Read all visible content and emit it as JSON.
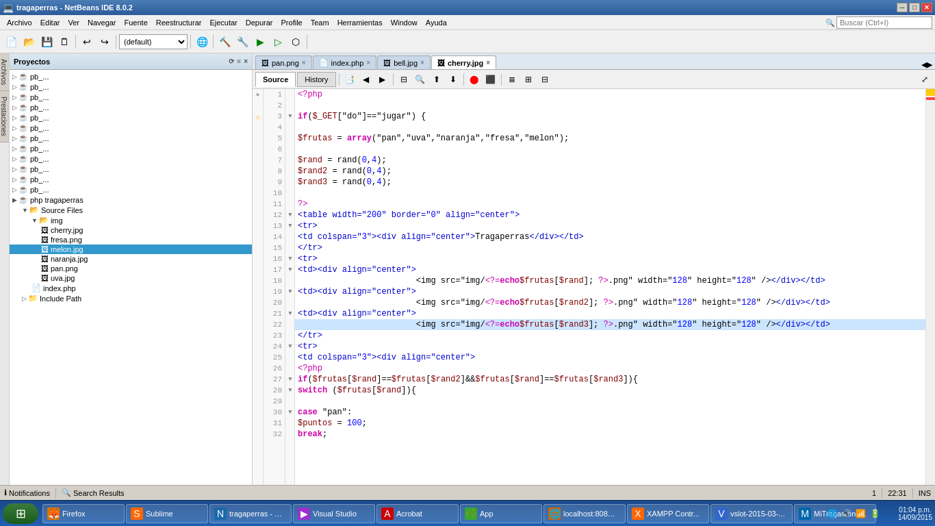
{
  "window": {
    "title": "tragaperras - NetBeans IDE 8.0.2",
    "controls": [
      "minimize",
      "restore",
      "close"
    ]
  },
  "menu": {
    "items": [
      "Archivo",
      "Editar",
      "Ver",
      "Navegar",
      "Fuente",
      "Reestructurar",
      "Ejecutar",
      "Depurar",
      "Profile",
      "Team",
      "Herramientas",
      "Window",
      "Ayuda"
    ]
  },
  "toolbar": {
    "dropdown_default": "(default)",
    "search_placeholder": "Buscar (Ctrl+I)"
  },
  "project_panel": {
    "title": "Proyectos",
    "close_btn": "×",
    "tree": [
      {
        "indent": 0,
        "icon": "▷",
        "label": "pb_...",
        "type": "project"
      },
      {
        "indent": 0,
        "icon": "▷",
        "label": "pb_...",
        "type": "project"
      },
      {
        "indent": 0,
        "icon": "▷",
        "label": "pb_...",
        "type": "project"
      },
      {
        "indent": 0,
        "icon": "▷",
        "label": "pb_...",
        "type": "project"
      },
      {
        "indent": 0,
        "icon": "▷",
        "label": "pb_...",
        "type": "project"
      },
      {
        "indent": 0,
        "icon": "▷",
        "label": "pb_...",
        "type": "project"
      },
      {
        "indent": 0,
        "icon": "▷",
        "label": "pb_...",
        "type": "project"
      },
      {
        "indent": 0,
        "icon": "▷",
        "label": "pb_...",
        "type": "project"
      },
      {
        "indent": 0,
        "icon": "▷",
        "label": "pb_...",
        "type": "project"
      },
      {
        "indent": 0,
        "icon": "▷",
        "label": "pb_...",
        "type": "project"
      },
      {
        "indent": 0,
        "icon": "▷",
        "label": "pb_...",
        "type": "project"
      },
      {
        "indent": 0,
        "icon": "▷",
        "label": "pb_...",
        "type": "project"
      },
      {
        "indent": 0,
        "icon": "▶",
        "label": "php  tragaperras",
        "type": "project-main"
      },
      {
        "indent": 1,
        "icon": "▼",
        "label": "Source Files",
        "type": "folder-open"
      },
      {
        "indent": 2,
        "icon": "▼",
        "label": "img",
        "type": "folder-open"
      },
      {
        "indent": 3,
        "icon": "📄",
        "label": "cherry.jpg",
        "type": "file"
      },
      {
        "indent": 3,
        "icon": "📄",
        "label": "fresa.png",
        "type": "file"
      },
      {
        "indent": 3,
        "icon": "📄",
        "label": "melon.jpg",
        "type": "file-selected"
      },
      {
        "indent": 3,
        "icon": "📄",
        "label": "naranja.jpg",
        "type": "file"
      },
      {
        "indent": 3,
        "icon": "📄",
        "label": "pan.png",
        "type": "file"
      },
      {
        "indent": 3,
        "icon": "📄",
        "label": "uva.jpg",
        "type": "file"
      },
      {
        "indent": 2,
        "icon": "📄",
        "label": "index.php",
        "type": "file"
      },
      {
        "indent": 1,
        "icon": "▷",
        "label": "Include Path",
        "type": "folder"
      }
    ]
  },
  "editor": {
    "tabs": [
      {
        "label": "pan.png",
        "active": false,
        "icon": "🖼"
      },
      {
        "label": "index.php",
        "active": false,
        "icon": "📄"
      },
      {
        "label": "bell.jpg",
        "active": false,
        "icon": "🖼"
      },
      {
        "label": "cherry.jpg",
        "active": true,
        "icon": "🖼"
      }
    ],
    "source_tabs": [
      "Source",
      "History"
    ],
    "active_source_tab": "Source",
    "lines": [
      {
        "num": 1,
        "code": "<?php",
        "type": "php",
        "fold": "",
        "icon": ""
      },
      {
        "num": 2,
        "code": "",
        "type": "plain",
        "fold": "",
        "icon": ""
      },
      {
        "num": 3,
        "code": "if($_GET[\"do\"]==\"jugar\") {",
        "type": "php",
        "fold": "▼",
        "icon": "⚠"
      },
      {
        "num": 4,
        "code": "",
        "type": "plain",
        "fold": "",
        "icon": ""
      },
      {
        "num": 5,
        "code": "        $frutas = array(\"pan\",\"uva\",\"naranja\",\"fresa\",\"melon\");",
        "type": "php",
        "fold": "",
        "icon": ""
      },
      {
        "num": 6,
        "code": "",
        "type": "plain",
        "fold": "",
        "icon": ""
      },
      {
        "num": 7,
        "code": "        $rand = rand(0,4);",
        "type": "php",
        "fold": "",
        "icon": ""
      },
      {
        "num": 8,
        "code": "        $rand2 = rand(0,4);",
        "type": "php",
        "fold": "",
        "icon": ""
      },
      {
        "num": 9,
        "code": "        $rand3 = rand(0,4);",
        "type": "php",
        "fold": "",
        "icon": ""
      },
      {
        "num": 10,
        "code": "",
        "type": "plain",
        "fold": "",
        "icon": ""
      },
      {
        "num": 11,
        "code": "        ?>",
        "type": "php",
        "fold": "",
        "icon": ""
      },
      {
        "num": 12,
        "code": "        <table width=\"200\" border=\"0\" align=\"center\">",
        "type": "html",
        "fold": "▼",
        "icon": ""
      },
      {
        "num": 13,
        "code": "            <tr>",
        "type": "html",
        "fold": "▼",
        "icon": ""
      },
      {
        "num": 14,
        "code": "                <td colspan=\"3\"><div align=\"center\">Tragaperras</div></td>",
        "type": "html",
        "fold": "",
        "icon": ""
      },
      {
        "num": 15,
        "code": "            </tr>",
        "type": "html",
        "fold": "",
        "icon": ""
      },
      {
        "num": 16,
        "code": "            <tr>",
        "type": "html",
        "fold": "▼",
        "icon": ""
      },
      {
        "num": 17,
        "code": "                <td><div align=\"center\">",
        "type": "html",
        "fold": "▼",
        "icon": ""
      },
      {
        "num": 18,
        "code": "                        <img src=\"img/<?= echo $frutas[$rand]; ?>.png\" width=\"128\" height=\"128\" /></div></td>",
        "type": "html",
        "fold": "",
        "icon": ""
      },
      {
        "num": 19,
        "code": "                <td><div align=\"center\">",
        "type": "html",
        "fold": "▼",
        "icon": ""
      },
      {
        "num": 20,
        "code": "                        <img src=\"img/<?= echo $frutas[$rand2]; ?>.png\" width=\"128\" height=\"128\" /></div></td>",
        "type": "html",
        "fold": "",
        "icon": ""
      },
      {
        "num": 21,
        "code": "                <td><div align=\"center\">",
        "type": "html",
        "fold": "▼",
        "icon": ""
      },
      {
        "num": 22,
        "code": "                        <img src=\"img/<?= echo $frutas[$rand3]; ?>.png\" width=\"128\" height=\"128\" /></div></td>",
        "type": "html",
        "fold": "",
        "icon": "",
        "highlighted": true
      },
      {
        "num": 23,
        "code": "            </tr>",
        "type": "html",
        "fold": "",
        "icon": ""
      },
      {
        "num": 24,
        "code": "            <tr>",
        "type": "html",
        "fold": "▼",
        "icon": ""
      },
      {
        "num": 25,
        "code": "                <td colspan=\"3\"><div align=\"center\">",
        "type": "html",
        "fold": "",
        "icon": ""
      },
      {
        "num": 26,
        "code": "        <?php",
        "type": "php",
        "fold": "",
        "icon": ""
      },
      {
        "num": 27,
        "code": "if($frutas[$rand]==$frutas[$rand2]&&$frutas[$rand]==$frutas[$rand3]){",
        "type": "php",
        "fold": "▼",
        "icon": ""
      },
      {
        "num": 28,
        "code": "            switch ($frutas[$rand]){",
        "type": "php",
        "fold": "▼",
        "icon": ""
      },
      {
        "num": 29,
        "code": "",
        "type": "plain",
        "fold": "",
        "icon": ""
      },
      {
        "num": 30,
        "code": "                case \"pan\":",
        "type": "php",
        "fold": "▼",
        "icon": ""
      },
      {
        "num": 31,
        "code": "                    $puntos = 100;",
        "type": "php",
        "fold": "",
        "icon": ""
      },
      {
        "num": 32,
        "code": "                    break;",
        "type": "php",
        "fold": "",
        "icon": ""
      }
    ]
  },
  "status_bar": {
    "notifications": "Notifications",
    "search_results": "Search Results",
    "notification_count": "1",
    "time": "22:31",
    "insert_mode": "INS",
    "line_col": ""
  },
  "taskbar": {
    "start_icon": "⊞",
    "items": [
      {
        "icon": "🦊",
        "label": "Firefox",
        "color": "#e87000"
      },
      {
        "icon": "S",
        "label": "Sublime",
        "color": "#ff6600"
      },
      {
        "icon": "N",
        "label": "tragaperras - N...",
        "color": "#1a6aaa"
      },
      {
        "icon": "▶",
        "label": "Visual Studio",
        "color": "#9932cc"
      },
      {
        "icon": "A",
        "label": "Acrobat",
        "color": "#cc0000"
      },
      {
        "icon": "🌿",
        "label": "App",
        "color": "#33aa33"
      },
      {
        "icon": "🌐",
        "label": "localhost:8080...",
        "color": "#cc6600"
      },
      {
        "icon": "X",
        "label": "XAMPP Contr...",
        "color": "#ff6600"
      },
      {
        "icon": "V",
        "label": "vslot-2015-03-...",
        "color": "#3366cc"
      },
      {
        "icon": "M",
        "label": "MiTragamone...",
        "color": "#0066aa"
      }
    ],
    "tray_icons": [
      "🔊",
      "📶",
      "💻"
    ],
    "time": "01:04 p.m.",
    "date": "14/09/2015"
  },
  "side_tabs": [
    "Archivos",
    "Prestaciones"
  ]
}
